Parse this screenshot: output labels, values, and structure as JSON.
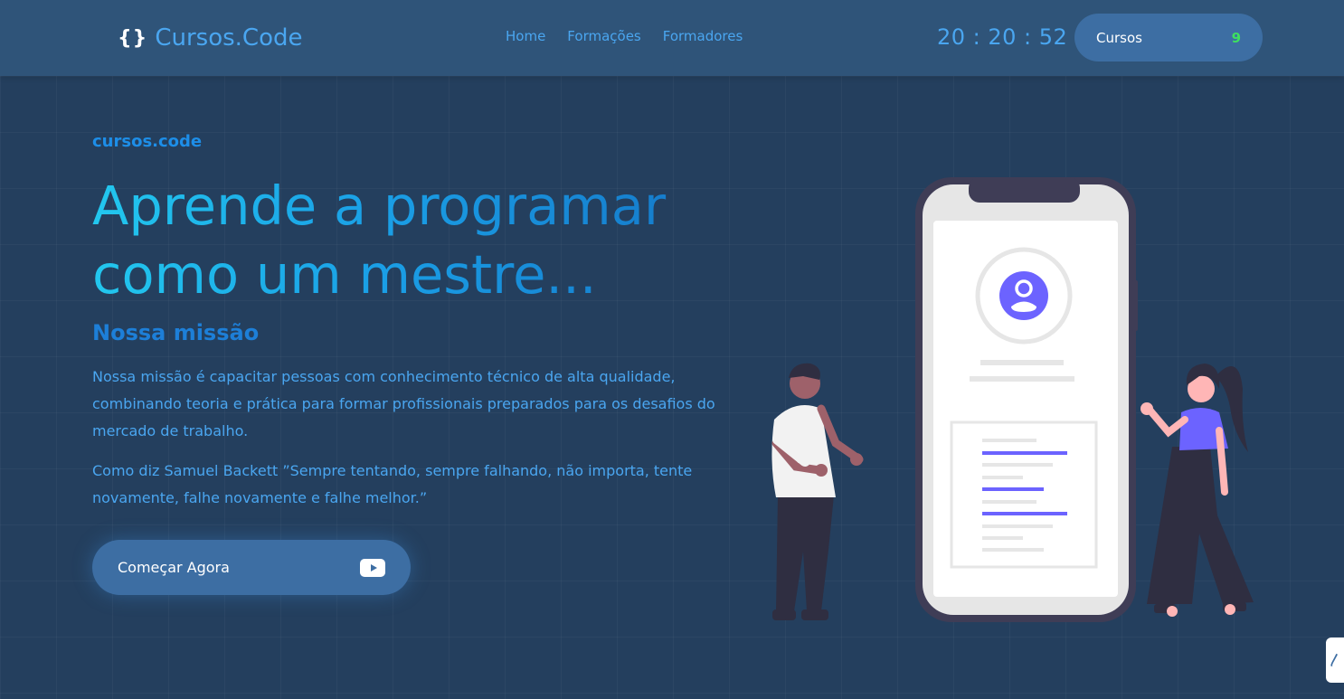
{
  "header": {
    "logo_icon": "{}",
    "logo_text": "Cursos.Code",
    "nav": [
      "Home",
      "Formações",
      "Formadores"
    ],
    "clock": "20 : 20 : 52",
    "cart": {
      "label": "Cursos",
      "count": "9",
      "count_color": "#3ee05f"
    }
  },
  "hero": {
    "eyebrow": "cursos.code",
    "headline": "Aprende a programar como um mestre...",
    "mission_title": "Nossa missão",
    "paragraph1": "Nossa missão é capacitar pessoas com conhecimento técnico de alta qualidade, combinando teoria e prática para formar profissionais preparados para os desafios do mercado de trabalho.",
    "paragraph2": "Como diz Samuel Backett ”Sempre tentando, sempre falhando, não importa, tente novamente, falhe novamente e falhe melhor.”",
    "cta_label": "Começar Agora",
    "cta_icon": "youtube-play-icon"
  },
  "side_widget": {
    "icon": "chart-widget-icon"
  },
  "colors": {
    "background": "#243f5e",
    "topbar": "#2f5479",
    "accent": "#4aa6f0",
    "button": "#3d6ea3",
    "illustration_accent": "#6c63ff"
  }
}
